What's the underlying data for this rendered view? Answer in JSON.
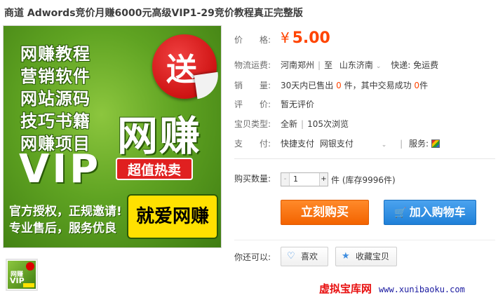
{
  "title": "商道 Adwords竞价月赚6000元高级VIP1-29竞价教程真正完整版",
  "image": {
    "lines": [
      "网赚教程",
      "营销软件",
      "网站源码",
      "技巧书籍",
      "网赚项目"
    ],
    "vip": "VIP",
    "circle": "送",
    "big": "网赚",
    "badge": "超值热卖",
    "bottom1": "官方授权，正规邀请!",
    "bottom2": "专业售后，服务优良",
    "yellow": "就爱网赚",
    "thumb_label": "网赚",
    "thumb_vip": "VIP"
  },
  "price": {
    "label": "价　　格:",
    "currency": "¥",
    "value": "5.00"
  },
  "shipping": {
    "label": "物流运费:",
    "from": "河南郑州",
    "to_word": "至",
    "to": "山东济南",
    "express": "快递: 免运费"
  },
  "sales": {
    "label": "销　　量:",
    "text_a": "30天内已售出",
    "sold": "0",
    "text_b": "件，其中交易成功",
    "success": "0",
    "text_c": "件"
  },
  "rating": {
    "label": "评　　价:",
    "value": "暂无评价"
  },
  "item_type": {
    "label": "宝贝类型:",
    "value": "全新",
    "views": "105次浏览"
  },
  "payment": {
    "label": "支　　付:",
    "opt1": "快捷支付",
    "opt2": "网银支付",
    "service": "服务:"
  },
  "quantity": {
    "label": "购买数量:",
    "value": "1",
    "minus": "-",
    "plus": "+",
    "stock": "件 (库存9996件)"
  },
  "buttons": {
    "buy": "立刻购买",
    "cart": "加入购物车"
  },
  "extra": {
    "label": "你还可以:",
    "like": "喜欢",
    "fav": "收藏宝贝"
  },
  "watermark": {
    "cn": "虚拟宝库网",
    "url": "www.xunibaoku.com"
  },
  "colors": {
    "price": "#ff4400",
    "buy": "#f36300",
    "cart": "#1f80d8"
  }
}
